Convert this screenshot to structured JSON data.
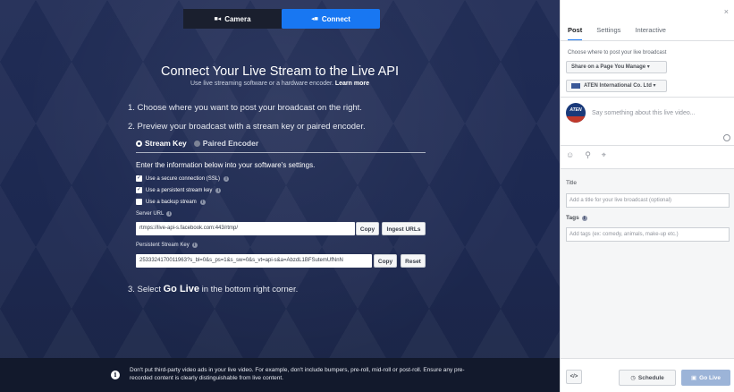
{
  "tabs": {
    "camera": "Camera",
    "connect": "Connect"
  },
  "hero": {
    "title": "Connect Your Live Stream to the Live API",
    "subtitle": "Use live streaming software or a hardware encoder.",
    "learn_more": "Learn more"
  },
  "steps": {
    "step1": "1. Choose where you want to post your broadcast on the right.",
    "step2": "2. Preview your broadcast with a stream key or paired encoder.",
    "step3_prefix": "3. Select",
    "step3_bold": "Go Live",
    "step3_suffix": "in the bottom right corner."
  },
  "mode": {
    "stream_key": "Stream Key",
    "paired_encoder": "Paired Encoder"
  },
  "enter_info": "Enter the information below into your software's settings.",
  "options": {
    "ssl": "Use a secure connection (SSL)",
    "persistent": "Use a persistent stream key",
    "backup": "Use a backup stream"
  },
  "server_url": {
    "label": "Server URL",
    "value": "rtmps://live-api-s.facebook.com:443/rtmp/",
    "copy": "Copy",
    "ingest": "Ingest URLs"
  },
  "stream_key": {
    "label": "Persistent Stream Key",
    "value": "2533324170011963?s_bl=0&s_ps=1&s_sw=0&s_vt=api-s&a=AbzdL1BFSutemUfNnN",
    "copy": "Copy",
    "reset": "Reset"
  },
  "footer_notice": "Don't put third-party video ads in your live video. For example, don't include bumpers, pre-roll, mid-roll or post-roll. Ensure any pre-recorded content is clearly distinguishable from live content.",
  "panel": {
    "close": "×",
    "tabs": [
      "Post",
      "Settings",
      "Interactive"
    ],
    "choose_label": "Choose where to post your live broadcast",
    "destination": "Share on a Page You Manage ▾",
    "page": "ATEN International Co. Ltd ▾",
    "avatar_text": "ATEN",
    "composer_placeholder": "Say something about this live video...",
    "title_label": "Title",
    "title_placeholder": "Add a title for your live broadcast (optional)",
    "tags_label": "Tags",
    "tags_placeholder": "Add tags (ex: comedy, animals, make-up etc.)",
    "code_button": "</>",
    "schedule": "Schedule",
    "go_live": "Go Live"
  },
  "colors": {
    "accent": "#1877f2",
    "background": "#1d2a4f",
    "go_live_disabled": "#9cb4d8"
  }
}
